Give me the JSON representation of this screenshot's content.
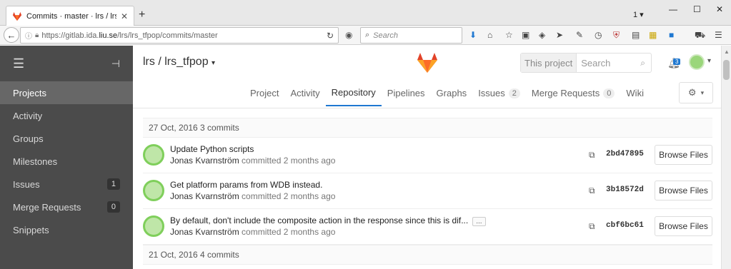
{
  "browser": {
    "tab_title": "Commits · master · lrs / lrs_tfpop ·...",
    "url_prefix": "https://gitlab.ida.",
    "url_domain": "liu.se",
    "url_path": "/lrs/lrs_tfpop/commits/master",
    "search_placeholder": "Search",
    "tab_count": "1"
  },
  "sidebar": {
    "items": [
      {
        "label": "Projects",
        "badge": ""
      },
      {
        "label": "Activity",
        "badge": ""
      },
      {
        "label": "Groups",
        "badge": ""
      },
      {
        "label": "Milestones",
        "badge": ""
      },
      {
        "label": "Issues",
        "badge": "1"
      },
      {
        "label": "Merge Requests",
        "badge": "0"
      },
      {
        "label": "Snippets",
        "badge": ""
      }
    ]
  },
  "header": {
    "project_path": "lrs / lrs_tfpop",
    "search_scope": "This project",
    "search_placeholder": "Search",
    "todo_count": "3"
  },
  "nav": {
    "project": "Project",
    "activity": "Activity",
    "repository": "Repository",
    "pipelines": "Pipelines",
    "graphs": "Graphs",
    "issues": "Issues",
    "issues_count": "2",
    "merge_requests": "Merge Requests",
    "merge_requests_count": "0",
    "wiki": "Wiki"
  },
  "commits": {
    "day1": "27 Oct, 2016 3 commits",
    "day2": "21 Oct, 2016 4 commits",
    "browse_label": "Browse Files",
    "rows": [
      {
        "title": "Update Python scripts",
        "author": "Jonas Kvarnström",
        "time": "committed 2 months ago",
        "sha": "2bd47895"
      },
      {
        "title": "Get platform params from WDB instead.",
        "author": "Jonas Kvarnström",
        "time": "committed 2 months ago",
        "sha": "3b18572d"
      },
      {
        "title": "By default, don't include the composite action in the response since this is dif...",
        "author": "Jonas Kvarnström",
        "time": "committed 2 months ago",
        "sha": "cbf6bc61",
        "ellipsis": "..."
      }
    ]
  },
  "colors": {
    "sidebar_bg": "#4b4b4b",
    "sidebar_active": "#676767",
    "accent": "#1f78d1",
    "gitlab_orange": "#e24329"
  }
}
